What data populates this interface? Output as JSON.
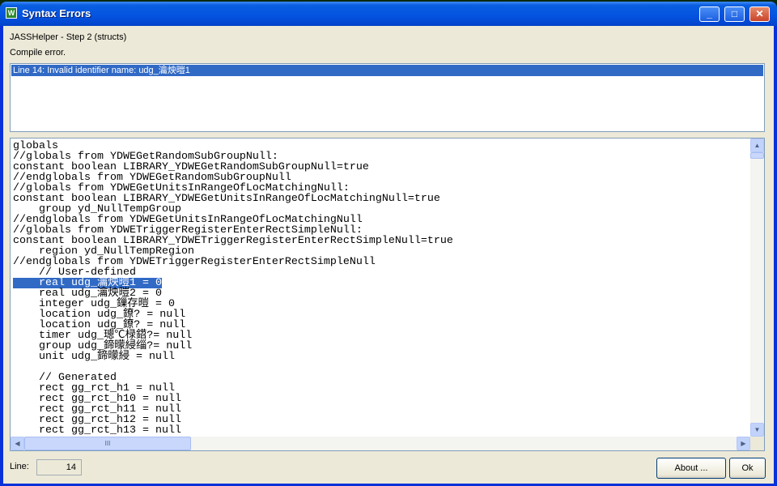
{
  "window": {
    "title": "Syntax Errors",
    "icon": "app-icon",
    "controls": {
      "minimize": "_",
      "maximize": "□",
      "close": "✕"
    }
  },
  "header": {
    "step": "JASSHelper - Step 2 (structs)",
    "status": "Compile error."
  },
  "errors": [
    "Line 14: Invalid identifier name: udg_瀹炴暟1"
  ],
  "code_lines": [
    "globals",
    "//globals from YDWEGetRandomSubGroupNull:",
    "constant boolean LIBRARY_YDWEGetRandomSubGroupNull=true",
    "//endglobals from YDWEGetRandomSubGroupNull",
    "//globals from YDWEGetUnitsInRangeOfLocMatchingNull:",
    "constant boolean LIBRARY_YDWEGetUnitsInRangeOfLocMatchingNull=true",
    "    group yd_NullTempGroup",
    "//endglobals from YDWEGetUnitsInRangeOfLocMatchingNull",
    "//globals from YDWETriggerRegisterEnterRectSimpleNull:",
    "constant boolean LIBRARY_YDWETriggerRegisterEnterRectSimpleNull=true",
    "    region yd_NullTempRegion",
    "//endglobals from YDWETriggerRegisterEnterRectSimpleNull",
    "    // User-defined",
    "    real udg_瀹炴暟1 = 0",
    "    real udg_瀹炴暟2 = 0",
    "    integer udg_鏁存暟 = 0",
    "    location udg_鐐? = null",
    "    location udg_鐐? = null",
    "    timer udg_璁℃椂鍣?= null",
    "    group udg_鍗曚綅缁?= null",
    "    unit udg_鍗曚綅 = null",
    "",
    "    // Generated",
    "    rect gg_rct_h1 = null",
    "    rect gg_rct_h10 = null",
    "    rect gg_rct_h11 = null",
    "    rect gg_rct_h12 = null",
    "    rect gg_rct_h13 = null"
  ],
  "selected_line": 14,
  "footer": {
    "line_label": "Line:",
    "line_value": "14",
    "about_label": "About ...",
    "ok_label": "Ok"
  },
  "scroll": {
    "up": "▲",
    "down": "▼",
    "left": "◀",
    "right": "▶",
    "grip": "III"
  }
}
